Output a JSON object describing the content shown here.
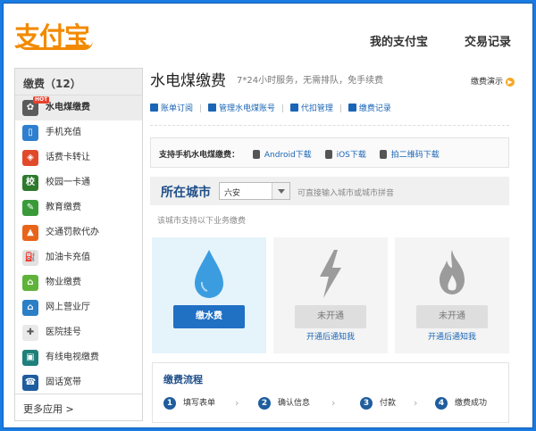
{
  "header": {
    "logo": "支付宝",
    "nav": [
      "我的支付宝",
      "交易记录"
    ]
  },
  "sidebar": {
    "title": "缴费（12）",
    "items": [
      {
        "label": "水电煤缴费",
        "icon": "utility-icon",
        "color": "#5b5b5b",
        "glyph": "✿",
        "active": true,
        "badge": "HOT"
      },
      {
        "label": "手机充值",
        "icon": "phone-icon",
        "color": "#2f7fcf",
        "glyph": "▯"
      },
      {
        "label": "话费卡转让",
        "icon": "phone-card-icon",
        "color": "#e04a2a",
        "glyph": "◈"
      },
      {
        "label": "校园一卡通",
        "icon": "campus-card-icon",
        "color": "#2d7a2d",
        "glyph": "校"
      },
      {
        "label": "教育缴费",
        "icon": "education-icon",
        "color": "#3a9a3a",
        "glyph": "✎"
      },
      {
        "label": "交通罚款代办",
        "icon": "traffic-icon",
        "color": "#e8641a",
        "glyph": "▲"
      },
      {
        "label": "加油卡充值",
        "icon": "fuel-icon",
        "color": "#e2e2e2",
        "glyph": "⛽"
      },
      {
        "label": "物业缴费",
        "icon": "property-icon",
        "color": "#5fb33a",
        "glyph": "⌂"
      },
      {
        "label": "网上营业厅",
        "icon": "online-hall-icon",
        "color": "#2a7fc6",
        "glyph": "⌂"
      },
      {
        "label": "医院挂号",
        "icon": "hospital-icon",
        "color": "#e9e9e9",
        "glyph": "✚"
      },
      {
        "label": "有线电视缴费",
        "icon": "tv-icon",
        "color": "#1f7f7a",
        "glyph": "▣"
      },
      {
        "label": "固话宽带",
        "icon": "broadband-icon",
        "color": "#1f5d9e",
        "glyph": "☎"
      }
    ],
    "more": "更多应用 >"
  },
  "main": {
    "title": "水电煤缴费",
    "subtitle": "7*24小时服务，无需排队，免手续费",
    "demo": "缴费演示",
    "links": [
      "账单订阅",
      "管理水电煤账号",
      "代扣管理",
      "缴费记录"
    ],
    "app_bar": {
      "label": "支持手机水电煤缴费：",
      "links": [
        "Android下载",
        "iOS下载",
        "拍二维码下载"
      ]
    },
    "city": {
      "label": "所在城市",
      "value": "六安",
      "hint": "可直接输入城市或城市拼音"
    },
    "support_note": "该城市支持以下业务缴费",
    "cards": [
      {
        "button": "缴水费",
        "status": "active"
      },
      {
        "button": "未开通",
        "notify": "开通后通知我"
      },
      {
        "button": "未开通",
        "notify": "开通后通知我"
      }
    ],
    "process": {
      "title": "缴费流程",
      "steps": [
        {
          "num": "1",
          "label": "填写表单"
        },
        {
          "num": "2",
          "label": "确认信息"
        },
        {
          "num": "3",
          "label": "付款"
        },
        {
          "num": "4",
          "label": "缴费成功"
        }
      ]
    }
  },
  "colors": {
    "frame": "#1a7be0",
    "brand_orange": "#f28a00",
    "link_blue": "#1a65b5",
    "primary_button": "#2070c4"
  }
}
